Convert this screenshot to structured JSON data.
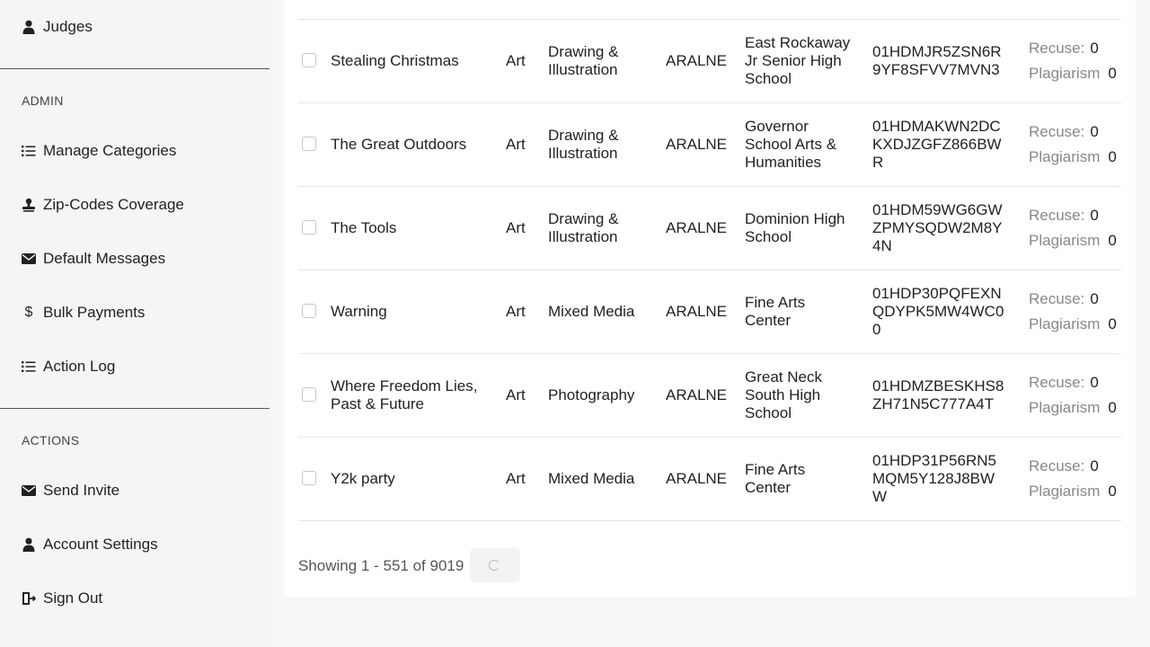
{
  "sidebar": {
    "top_item": {
      "label": "Judges",
      "icon": "user-icon"
    },
    "admin_title": "ADMIN",
    "admin_items": [
      {
        "label": "Manage Categories",
        "icon": "list-icon"
      },
      {
        "label": "Zip-Codes Coverage",
        "icon": "stamp-icon"
      },
      {
        "label": "Default Messages",
        "icon": "envelope-icon"
      },
      {
        "label": "Bulk Payments",
        "icon": "dollar-icon"
      },
      {
        "label": "Action Log",
        "icon": "list-icon"
      }
    ],
    "actions_title": "ACTIONS",
    "action_items": [
      {
        "label": "Send Invite",
        "icon": "envelope-icon"
      },
      {
        "label": "Account Settings",
        "icon": "user-icon"
      },
      {
        "label": "Sign Out",
        "icon": "sign-out-icon"
      }
    ]
  },
  "table": {
    "rows": [
      {
        "title": [
          "Stealing Christmas"
        ],
        "type": "Art",
        "category": [
          "Drawing &",
          "Illustration"
        ],
        "code": "ARALNE",
        "school": [
          "East Rockaway",
          "Jr Senior High",
          "School"
        ],
        "id": [
          "01HDMJR5ZSN6R",
          "9YF8SFVV7MVN3"
        ],
        "recuse_label": "Recuse:",
        "recuse": "0",
        "plagiarism_label": "Plagiarism",
        "plagiarism": "0"
      },
      {
        "title": [
          "The Great Outdoors"
        ],
        "type": "Art",
        "category": [
          "Drawing &",
          "Illustration"
        ],
        "code": "ARALNE",
        "school": [
          "Governor",
          "School Arts &",
          "Humanities"
        ],
        "id": [
          "01HDMAKWN2DC",
          "KXDJZGFZ866BW",
          "R"
        ],
        "recuse_label": "Recuse:",
        "recuse": "0",
        "plagiarism_label": "Plagiarism",
        "plagiarism": "0"
      },
      {
        "title": [
          "The Tools"
        ],
        "type": "Art",
        "category": [
          "Drawing &",
          "Illustration"
        ],
        "code": "ARALNE",
        "school": [
          "Dominion High",
          "School"
        ],
        "id": [
          "01HDM59WG6GW",
          "ZPMYSQDW2M8Y",
          "4N"
        ],
        "recuse_label": "Recuse:",
        "recuse": "0",
        "plagiarism_label": "Plagiarism",
        "plagiarism": "0"
      },
      {
        "title": [
          "Warning"
        ],
        "type": "Art",
        "category": [
          "Mixed Media"
        ],
        "code": "ARALNE",
        "school": [
          "Fine Arts",
          "Center"
        ],
        "id": [
          "01HDP30PQFEXN",
          "QDYPK5MW4WC0",
          "0"
        ],
        "recuse_label": "Recuse:",
        "recuse": "0",
        "plagiarism_label": "Plagiarism",
        "plagiarism": "0"
      },
      {
        "title": [
          "Where Freedom Lies,",
          "Past & Future"
        ],
        "type": "Art",
        "category": [
          "Photography"
        ],
        "code": "ARALNE",
        "school": [
          "Great Neck",
          "South High",
          "School"
        ],
        "id": [
          "01HDMZBESKHS8",
          "ZH71N5C777A4T"
        ],
        "recuse_label": "Recuse:",
        "recuse": "0",
        "plagiarism_label": "Plagiarism",
        "plagiarism": "0"
      },
      {
        "title": [
          "Y2k party"
        ],
        "type": "Art",
        "category": [
          "Mixed Media"
        ],
        "code": "ARALNE",
        "school": [
          "Fine Arts",
          "Center"
        ],
        "id": [
          "01HDP31P56RN5",
          "MQM5Y128J8BW",
          "W"
        ],
        "recuse_label": "Recuse:",
        "recuse": "0",
        "plagiarism_label": "Plagiarism",
        "plagiarism": "0"
      }
    ]
  },
  "pagination": {
    "showing_text": "Showing 1 - 551 of 9019"
  }
}
